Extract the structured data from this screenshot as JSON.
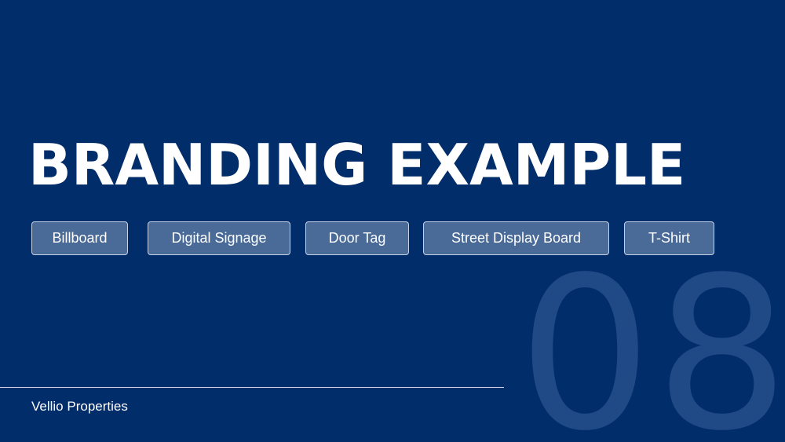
{
  "slide": {
    "title": "BRANDING EXAMPLE",
    "number": "08",
    "tags": [
      "Billboard",
      "Digital Signage",
      "Door Tag",
      "Street Display Board",
      "T-Shirt"
    ],
    "company": "Vellio Properties"
  },
  "colors": {
    "background": "#022d6b",
    "number": "#1f4a86",
    "tag_fill": "#4a6a97",
    "tag_border": "#c6d2e6",
    "text": "#ffffff"
  }
}
